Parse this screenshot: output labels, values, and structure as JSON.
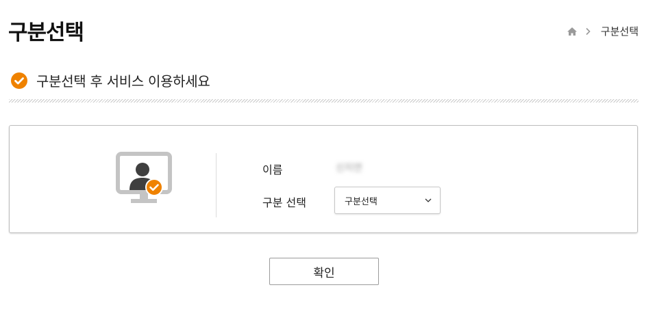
{
  "header": {
    "title": "구분선택",
    "breadcrumb": {
      "home_icon": "home-icon",
      "separator_icon": "chevron-right-icon",
      "current": "구분선택"
    }
  },
  "section": {
    "heading": "구분선택 후 서비스 이용하세요",
    "heading_icon": "check-circle-icon"
  },
  "form": {
    "illustration_icon": "user-monitor-check-icon",
    "name_label": "이름",
    "name_value": "신지연",
    "type_label": "구분 선택",
    "type_select": {
      "selected": "구분선택",
      "icon": "chevron-down-icon"
    }
  },
  "actions": {
    "confirm_label": "확인"
  },
  "colors": {
    "accent": "#ef8200",
    "monitor_gray": "#c4c4c4",
    "person_dark": "#3f3f3f"
  }
}
